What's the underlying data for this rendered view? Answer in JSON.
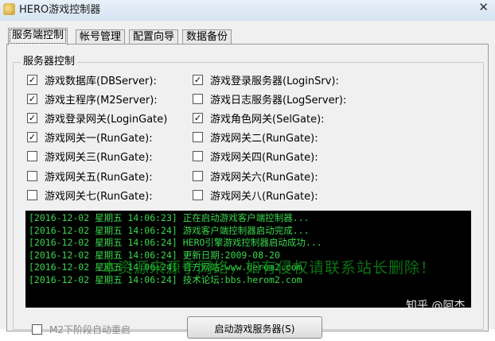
{
  "window": {
    "title": "HERO游戏控制器",
    "close_label": "✕"
  },
  "tabs": [
    {
      "label": "服务端控制",
      "active": true
    },
    {
      "label": "帐号管理",
      "active": false
    },
    {
      "label": "配置向导",
      "active": false
    },
    {
      "label": "数据备份",
      "active": false
    }
  ],
  "server_control": {
    "group_title": "服务器控制",
    "left": [
      {
        "label": "游戏数据库(DBServer):",
        "checked": true
      },
      {
        "label": "游戏主程序(M2Server):",
        "checked": true
      },
      {
        "label": "游戏登录网关(LoginGate)",
        "checked": true
      },
      {
        "label": "游戏网关一(RunGate):",
        "checked": true
      },
      {
        "label": "游戏网关三(RunGate):",
        "checked": false
      },
      {
        "label": "游戏网关五(RunGate):",
        "checked": false
      },
      {
        "label": "游戏网关七(RunGate):",
        "checked": false
      }
    ],
    "right": [
      {
        "label": "游戏登录服务器(LoginSrv):",
        "checked": true
      },
      {
        "label": "游戏日志服务器(LogServer):",
        "checked": false
      },
      {
        "label": "游戏角色网关(SelGate):",
        "checked": true
      },
      {
        "label": "游戏网关二(RunGate):",
        "checked": false
      },
      {
        "label": "游戏网关四(RunGate):",
        "checked": false
      },
      {
        "label": "游戏网关六(RunGate):",
        "checked": false
      },
      {
        "label": "游戏网关八(RunGate):",
        "checked": false
      }
    ]
  },
  "log": [
    "[2016-12-02 星期五 14:06:23] 正在启动游戏客户端控制器...",
    "[2016-12-02 星期五 14:06:24] 游戏客户端控制器启动完成...",
    "[2016-12-02 星期五 14:06:24] HERO引擎游戏控制器启动成功...",
    "[2016-12-02 星期五 14:06:24] 更新日期:2009-08-20",
    "[2016-12-02 星期五 14:06:24] 官方网站:www.herom2.com",
    "[2016-12-02 星期五 14:06:24] 技术论坛:bbs.herom2.com"
  ],
  "watermark": "本资源来源于网络，如有侵权请联系站长删除！",
  "credit": "知乎 @阿杰",
  "bottom": {
    "auto_restart_label": "M2下阶段自动重启",
    "start_button_label": "启动游戏服务器(S)"
  }
}
